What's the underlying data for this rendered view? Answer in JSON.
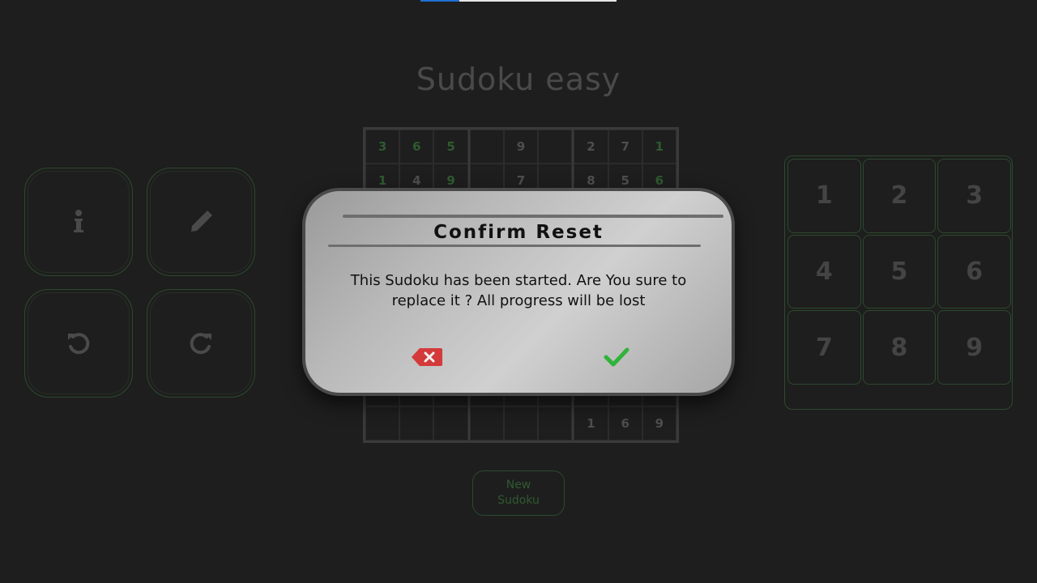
{
  "header": {
    "progress_percent": 20,
    "progress_fill_color": "#1f6fd1",
    "title": "Sudoku easy"
  },
  "actions": [
    {
      "icon": "info-icon"
    },
    {
      "icon": "pencil-icon"
    },
    {
      "icon": "undo-icon"
    },
    {
      "icon": "redo-icon"
    }
  ],
  "board": {
    "rows": [
      [
        "3",
        "6",
        "5",
        "",
        "9",
        "",
        "2",
        "7",
        "1"
      ],
      [
        "1",
        "4",
        "9",
        "",
        "7",
        "",
        "8",
        "5",
        "6"
      ],
      [
        "",
        "",
        "",
        "",
        "",
        "",
        "",
        "",
        ""
      ],
      [
        "",
        "",
        "",
        "",
        "",
        "",
        "",
        "",
        ""
      ],
      [
        "",
        "",
        "",
        "",
        "",
        "",
        "",
        "",
        ""
      ],
      [
        "",
        "",
        "",
        "",
        "",
        "",
        "",
        "",
        ""
      ],
      [
        "",
        "",
        "",
        "",
        "",
        "",
        "",
        "",
        ""
      ],
      [
        "",
        "",
        "",
        "",
        "",
        "",
        "",
        "",
        ""
      ],
      [
        "",
        "",
        "",
        "",
        "",
        "",
        "1",
        "6",
        "9"
      ]
    ],
    "given_color": "#2f5a2f"
  },
  "new_sudoku": {
    "line1": "New",
    "line2": "Sudoku"
  },
  "numpad": {
    "keys": [
      "1",
      "2",
      "3",
      "4",
      "5",
      "6",
      "7",
      "8",
      "9"
    ]
  },
  "modal": {
    "title": "Confirm Reset",
    "message": "This Sudoku has been started. Are You sure to replace it ? All progress will be lost",
    "cancel_icon": "backspace-x-icon",
    "cancel_color": "#d43a3a",
    "confirm_icon": "checkmark-icon",
    "confirm_color": "#2fb33a"
  }
}
